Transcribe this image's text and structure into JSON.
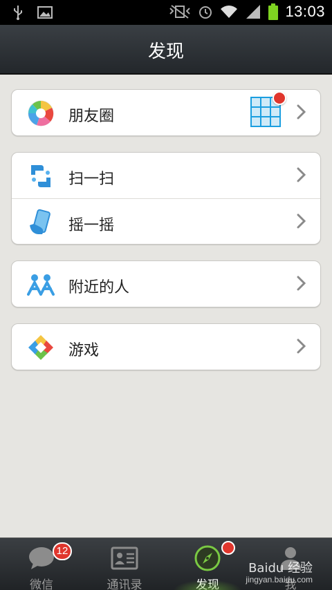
{
  "status_bar": {
    "time": "13:03",
    "icons": [
      "usb-icon",
      "image-icon",
      "vibrate-icon",
      "alarm-icon",
      "wifi-icon",
      "signal-icon",
      "battery-icon"
    ],
    "battery_color": "#7ed321"
  },
  "header": {
    "title": "发现"
  },
  "menu": {
    "moments": {
      "label": "朋友圈",
      "has_new": true
    },
    "scan": {
      "label": "扫一扫"
    },
    "shake": {
      "label": "摇一摇"
    },
    "nearby": {
      "label": "附近的人"
    },
    "games": {
      "label": "游戏"
    }
  },
  "tabs": [
    {
      "label": "微信",
      "icon": "chat-bubble-icon",
      "badge": "12"
    },
    {
      "label": "通讯录",
      "icon": "contact-card-icon"
    },
    {
      "label": "发现",
      "icon": "compass-icon",
      "active": true,
      "dot": true
    },
    {
      "label": "我",
      "icon": "person-icon"
    }
  ],
  "watermark": {
    "text": "Baidu 经验",
    "sub": "jingyan.baidu.com"
  },
  "colors": {
    "accent": "#7ac943",
    "badge": "#e0362d"
  }
}
